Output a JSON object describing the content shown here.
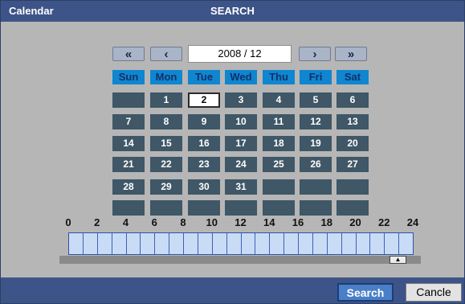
{
  "window": {
    "title_left": "Calendar",
    "title_center": "SEARCH"
  },
  "nav": {
    "first": "«",
    "prev": "‹",
    "month_label": "2008 / 12",
    "next": "›",
    "last": "»"
  },
  "weekdays": [
    "Sun",
    "Mon",
    "Tue",
    "Wed",
    "Thu",
    "Fri",
    "Sat"
  ],
  "days": [
    [
      "",
      "1",
      "2",
      "3",
      "4",
      "5",
      "6"
    ],
    [
      "7",
      "8",
      "9",
      "10",
      "11",
      "12",
      "13"
    ],
    [
      "14",
      "15",
      "16",
      "17",
      "18",
      "19",
      "20"
    ],
    [
      "21",
      "22",
      "23",
      "24",
      "25",
      "26",
      "27"
    ],
    [
      "28",
      "29",
      "30",
      "31",
      "",
      "",
      ""
    ],
    [
      "",
      "",
      "",
      "",
      "",
      "",
      ""
    ]
  ],
  "selected_day": "2",
  "hours": [
    "0",
    "2",
    "4",
    "6",
    "8",
    "10",
    "12",
    "14",
    "16",
    "18",
    "20",
    "22",
    "24"
  ],
  "timeline_slots": 24,
  "scroll_marker": "▲",
  "actions": {
    "search": "Search",
    "cancel": "Cancle"
  }
}
